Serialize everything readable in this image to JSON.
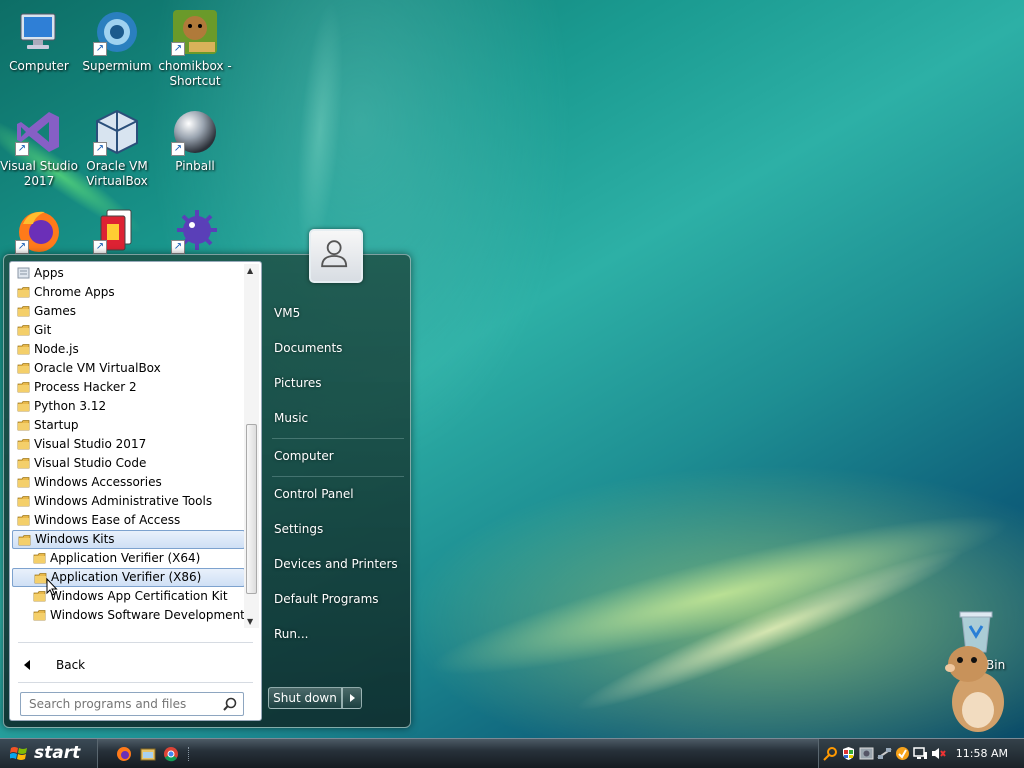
{
  "desktop": {
    "icons": [
      {
        "label": "Computer"
      },
      {
        "label": "Supermium"
      },
      {
        "label": "chomikbox - Shortcut"
      },
      {
        "label": "Visual Studio 2017"
      },
      {
        "label": "Oracle VM VirtualBox"
      },
      {
        "label": "Pinball"
      },
      {
        "label": "Firefox"
      },
      {
        "label": "Solitaire"
      },
      {
        "label": "Minesweeper"
      }
    ],
    "recycle_bin_label": "Bin"
  },
  "start_menu": {
    "programs": [
      {
        "label": "Apps"
      },
      {
        "label": "Chrome Apps"
      },
      {
        "label": "Games"
      },
      {
        "label": "Git"
      },
      {
        "label": "Node.js"
      },
      {
        "label": "Oracle VM VirtualBox"
      },
      {
        "label": "Process Hacker 2"
      },
      {
        "label": "Python 3.12"
      },
      {
        "label": "Startup"
      },
      {
        "label": "Visual Studio 2017"
      },
      {
        "label": "Visual Studio Code"
      },
      {
        "label": "Windows Accessories"
      },
      {
        "label": "Windows Administrative Tools"
      },
      {
        "label": "Windows Ease of Access"
      },
      {
        "label": "Windows Kits"
      },
      {
        "label": "Application Verifier (X64)"
      },
      {
        "label": "Application Verifier (X86)"
      },
      {
        "label": "Windows App Certification Kit"
      },
      {
        "label": "Windows Software Development Kit"
      }
    ],
    "back_label": "Back",
    "search_placeholder": "Search programs and files",
    "right_links": [
      {
        "label": "VM5"
      },
      {
        "label": "Documents"
      },
      {
        "label": "Pictures"
      },
      {
        "label": "Music"
      },
      {
        "label": "Computer"
      },
      {
        "label": "Control Panel"
      },
      {
        "label": "Settings"
      },
      {
        "label": "Devices and Printers"
      },
      {
        "label": "Default Programs"
      },
      {
        "label": "Run..."
      }
    ],
    "shutdown_label": "Shut down"
  },
  "taskbar": {
    "start_label": "start",
    "clock": "11:58 AM"
  },
  "colors": {
    "folder": "#e8b84a",
    "selection_border": "#7da2ce"
  }
}
